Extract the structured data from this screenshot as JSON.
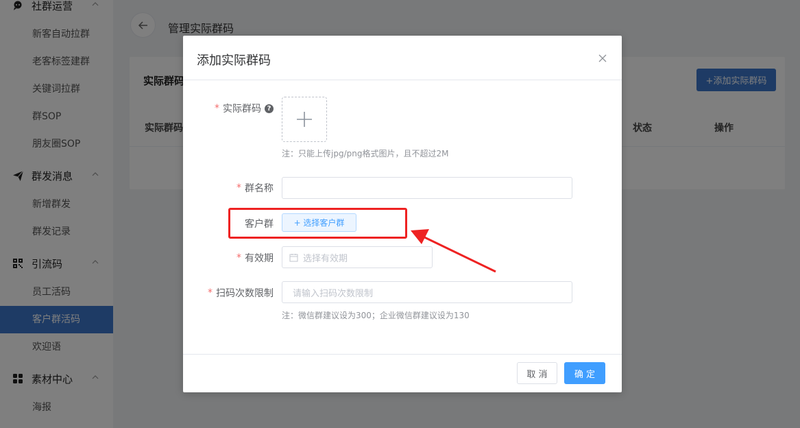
{
  "sidebar": {
    "sections": [
      {
        "label": "社群运营",
        "icon": "chat-icon"
      },
      {
        "label": "群发消息",
        "icon": "send-icon"
      },
      {
        "label": "引流码",
        "icon": "qrcode-icon"
      },
      {
        "label": "素材中心",
        "icon": "grid-icon"
      }
    ],
    "items": {
      "i0": "新客自动拉群",
      "i1": "老客标签建群",
      "i2": "关键词拉群",
      "i3": "群SOP",
      "i4": "朋友圈SOP",
      "i5": "新增群发",
      "i6": "群发记录",
      "i7": "员工活码",
      "i8": "客户群活码",
      "i9": "欢迎语",
      "i10": "海报"
    },
    "active_item": "客户群活码"
  },
  "header": {
    "title": "管理实际群码"
  },
  "card": {
    "title": "实际群码",
    "add_button": "+添加实际群码",
    "columns": {
      "col0": "实际群码",
      "col1": "状态",
      "col2": "操作"
    }
  },
  "dialog": {
    "title": "添加实际群码",
    "fields": {
      "qrcode": {
        "label": "实际群码",
        "required": true,
        "note": "注：只能上传jpg/png格式图片，且不超过2M"
      },
      "group_name": {
        "label": "群名称",
        "required": true,
        "value": ""
      },
      "customer_group": {
        "label": "客户群",
        "required": false,
        "button": "+ 选择客户群"
      },
      "valid_period": {
        "label": "有效期",
        "required": true,
        "placeholder": "选择有效期"
      },
      "scan_limit": {
        "label": "扫码次数限制",
        "required": true,
        "placeholder": "请输入扫码次数限制",
        "note": "注：微信群建议设为300；企业微信群建议设为130"
      }
    },
    "cancel": "取 消",
    "confirm": "确 定"
  },
  "annotation": {
    "highlight_color": "#ee2222"
  },
  "colors": {
    "primary": "#409eff",
    "sidebar_active": "#3d77ca",
    "required": "#f56c6c"
  }
}
